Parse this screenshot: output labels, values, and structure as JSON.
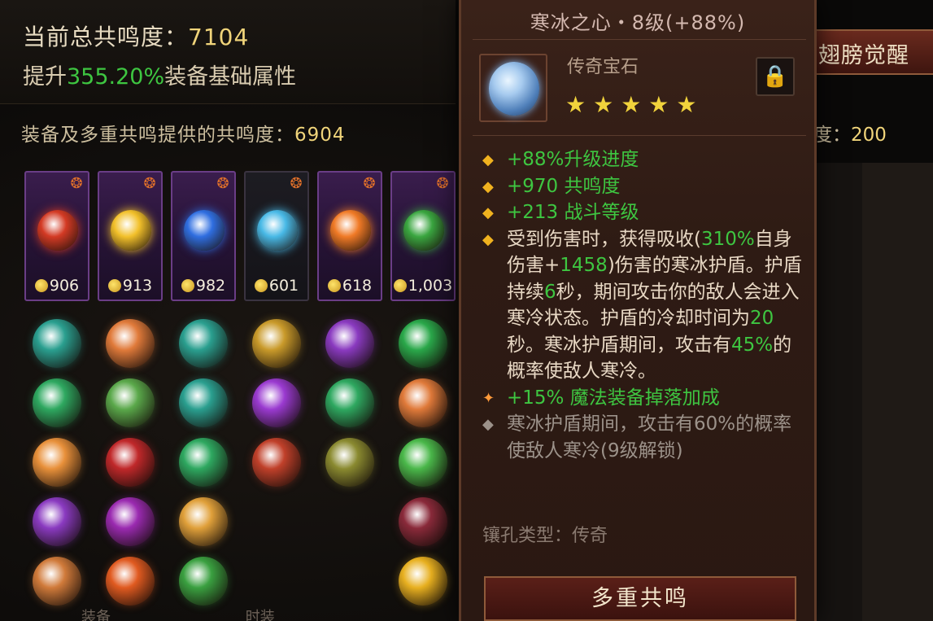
{
  "header": {
    "total_label": "当前总共鸣度：",
    "total_value": "7104",
    "boost_prefix": "提升",
    "boost_value": "355.20%",
    "boost_suffix": "装备基础属性"
  },
  "sub": {
    "label": "装备及多重共鸣提供的共鸣度：",
    "value": "6904",
    "right_label": "度：",
    "right_value": "200"
  },
  "awaken_button": "翅膀觉醒",
  "equipment": [
    {
      "cost": "906",
      "gem": "red-gem-icon",
      "color": "#d33a24"
    },
    {
      "cost": "913",
      "gem": "gold-gem-icon",
      "color": "#f2c02a"
    },
    {
      "cost": "982",
      "gem": "blue-gem-icon",
      "color": "#2f6ee0"
    },
    {
      "cost": "601",
      "gem": "ice-gem-icon",
      "color": "#48b9e6"
    },
    {
      "cost": "618",
      "gem": "fire-gem-icon",
      "color": "#f07a26"
    },
    {
      "cost": "1,003",
      "gem": "green-gem-icon",
      "color": "#3aa640"
    }
  ],
  "grid_colors": [
    [
      "#2a9f8f",
      "#e07a3a",
      "#2a9f8f",
      "#c99a2a",
      "#8a3ac0",
      "#2aa84a"
    ],
    [
      "#2ea860",
      "#5aa84a",
      "#2a9f8f",
      "#9a3ad0",
      "#2ea860",
      "#e07a3a"
    ],
    [
      "#e8903a",
      "#c0282a",
      "#2ea860",
      "#c0402a",
      "#8a8a30",
      "#4ab84a"
    ],
    [
      "#8a3ac0",
      "#9a2ab0",
      "#e0a03a",
      null,
      null,
      "#8a2a3a"
    ],
    [
      "#d07a3a",
      "#e05a20",
      "#3aa040",
      null,
      null,
      "#e8b020"
    ]
  ],
  "tooltip": {
    "title": "寒冰之心・8级(+88%)",
    "type": "传奇宝石",
    "stars": "★★★★★",
    "lock": "🔒",
    "lines": {
      "l1_g": "+88%",
      "l1_t": "升级进度",
      "l2_g": "+970",
      "l2_t": " 共鸣度",
      "l3_g": "+213",
      "l3_t": " 战斗等级",
      "l4_a": "受到伤害时，获得吸收(",
      "l4_g1": "310%",
      "l4_b": "自身伤害+",
      "l4_g2": "1458",
      "l4_c": ")伤害的寒冰护盾。护盾持续",
      "l4_g3": "6",
      "l4_d": "秒，期间攻击你的敌人会进入寒冷状态。护盾的冷却时间为",
      "l4_g4": "20",
      "l4_e": "秒。寒冰护盾期间，攻击有",
      "l4_g5": "45%",
      "l4_f": "的概率使敌人寒冷。",
      "l5_g": "+15%",
      "l5_t": " 魔法装备掉落加成",
      "l6": "寒冰护盾期间，攻击有60%的概率使敌人寒冷(9级解锁)"
    },
    "socket": "镶孔类型：传奇",
    "button": "多重共鸣"
  },
  "bottom_tabs": [
    "装备",
    "时装"
  ]
}
